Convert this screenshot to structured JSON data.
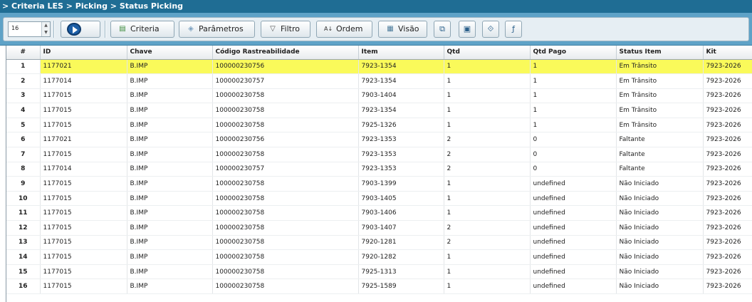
{
  "breadcrumb": "> Criteria LES > Picking > Status Picking",
  "toolbar": {
    "page_size": "16",
    "buttons": {
      "criteria": "Criteria",
      "parametros": "Parâmetros",
      "filtro": "Filtro",
      "ordem": "Ordem",
      "visao": "Visão"
    }
  },
  "table": {
    "columns": [
      "#",
      "ID",
      "Chave",
      "Código Rastreabilidade",
      "Item",
      "Qtd",
      "Qtd Pago",
      "Status Item",
      "Kit"
    ],
    "rows": [
      [
        "1",
        "1177021",
        "B.IMP",
        "100000230756",
        "7923-1354",
        "1",
        "1",
        "Em Trânsito",
        "7923-2026"
      ],
      [
        "2",
        "1177014",
        "B.IMP",
        "100000230757",
        "7923-1354",
        "1",
        "1",
        "Em Trânsito",
        "7923-2026"
      ],
      [
        "3",
        "1177015",
        "B.IMP",
        "100000230758",
        "7903-1404",
        "1",
        "1",
        "Em Trânsito",
        "7923-2026"
      ],
      [
        "4",
        "1177015",
        "B.IMP",
        "100000230758",
        "7923-1354",
        "1",
        "1",
        "Em Trânsito",
        "7923-2026"
      ],
      [
        "5",
        "1177015",
        "B.IMP",
        "100000230758",
        "7925-1326",
        "1",
        "1",
        "Em Trânsito",
        "7923-2026"
      ],
      [
        "6",
        "1177021",
        "B.IMP",
        "100000230756",
        "7923-1353",
        "2",
        "0",
        "Faltante",
        "7923-2026"
      ],
      [
        "7",
        "1177015",
        "B.IMP",
        "100000230758",
        "7923-1353",
        "2",
        "0",
        "Faltante",
        "7923-2026"
      ],
      [
        "8",
        "1177014",
        "B.IMP",
        "100000230757",
        "7923-1353",
        "2",
        "0",
        "Faltante",
        "7923-2026"
      ],
      [
        "9",
        "1177015",
        "B.IMP",
        "100000230758",
        "7903-1399",
        "1",
        "undefined",
        "Não Iniciado",
        "7923-2026"
      ],
      [
        "10",
        "1177015",
        "B.IMP",
        "100000230758",
        "7903-1405",
        "1",
        "undefined",
        "Não Iniciado",
        "7923-2026"
      ],
      [
        "11",
        "1177015",
        "B.IMP",
        "100000230758",
        "7903-1406",
        "1",
        "undefined",
        "Não Iniciado",
        "7923-2026"
      ],
      [
        "12",
        "1177015",
        "B.IMP",
        "100000230758",
        "7903-1407",
        "2",
        "undefined",
        "Não Iniciado",
        "7923-2026"
      ],
      [
        "13",
        "1177015",
        "B.IMP",
        "100000230758",
        "7920-1281",
        "2",
        "undefined",
        "Não Iniciado",
        "7923-2026"
      ],
      [
        "14",
        "1177015",
        "B.IMP",
        "100000230758",
        "7920-1282",
        "1",
        "undefined",
        "Não Iniciado",
        "7923-2026"
      ],
      [
        "15",
        "1177015",
        "B.IMP",
        "100000230758",
        "7925-1313",
        "1",
        "undefined",
        "Não Iniciado",
        "7923-2026"
      ],
      [
        "16",
        "1177015",
        "B.IMP",
        "100000230758",
        "7925-1589",
        "1",
        "undefined",
        "Não Iniciado",
        "7923-2026"
      ]
    ],
    "highlighted_row": 0,
    "highlight_color": "#fafa5a"
  },
  "icons": {
    "criteria": "criteria-icon",
    "parametros": "tag-icon",
    "filtro": "filter-icon",
    "ordem": "sort-az-icon",
    "visao": "view-icon"
  }
}
